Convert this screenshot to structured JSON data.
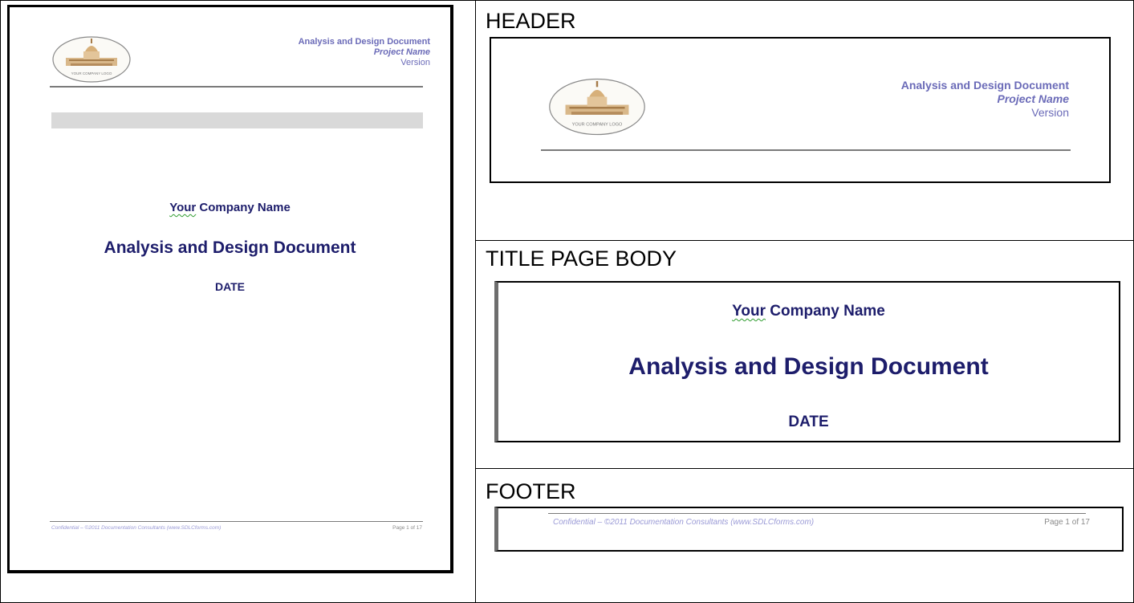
{
  "sections": {
    "header_label": "HEADER",
    "body_label": "TITLE PAGE BODY",
    "footer_label": "FOOTER"
  },
  "header": {
    "logo_caption": "YOUR COMPANY LOGO",
    "doc_title": "Analysis and Design Document",
    "project_name": "Project Name",
    "version": "Version"
  },
  "body": {
    "company": "Company Name",
    "company_prefix": "Your",
    "title": "Analysis and Design Document",
    "date": "DATE"
  },
  "footer": {
    "confidential": "Confidential – ©2011 Documentation Consultants (www.SDLCforms.com)",
    "page": "Page 1 of 17"
  },
  "colors": {
    "header_text": "#6b6bb8",
    "title_navy": "#1d1d6b",
    "footer_text": "#9a9ad6"
  }
}
